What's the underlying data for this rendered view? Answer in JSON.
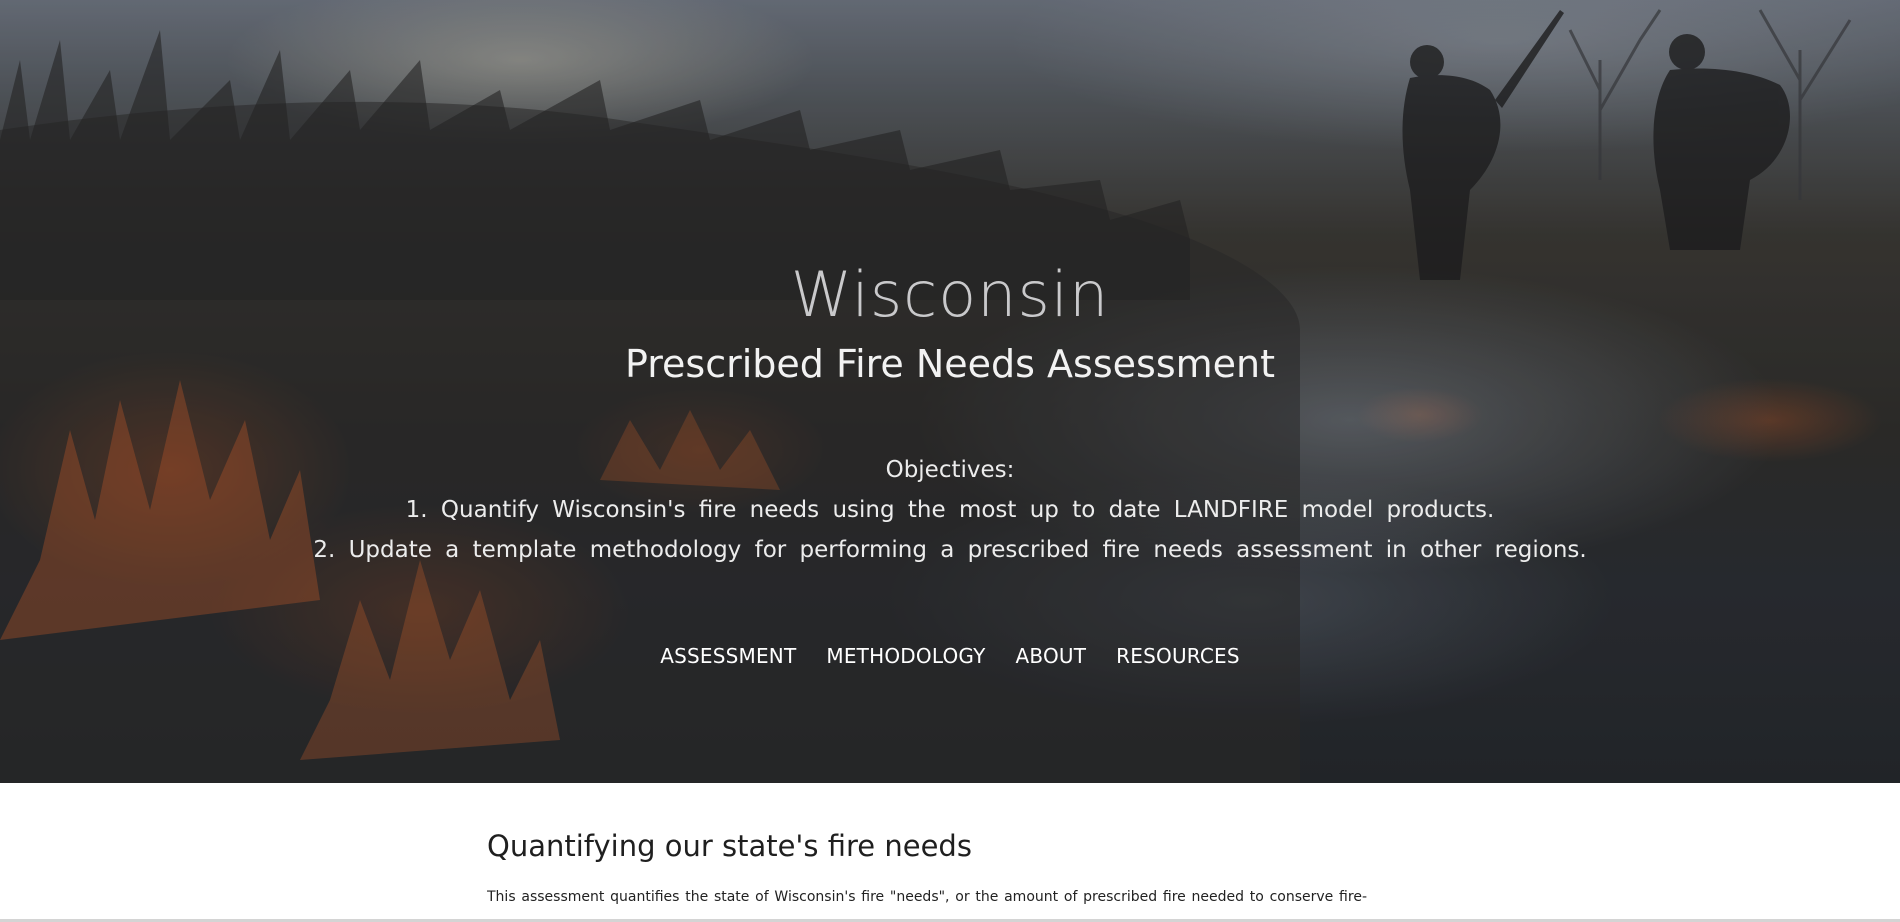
{
  "hero": {
    "title": "Wisconsin",
    "subtitle": "Prescribed Fire Needs Assessment",
    "objectives_heading": "Objectives:",
    "objectives": [
      "1. Quantify Wisconsin's fire needs using the most up to date LANDFIRE model products.",
      "2. Update a template methodology for performing a prescribed fire needs assessment in other regions."
    ],
    "background_image": "prescribed-burn-photo"
  },
  "nav": {
    "items": [
      {
        "label": "ASSESSMENT"
      },
      {
        "label": "METHODOLOGY"
      },
      {
        "label": "ABOUT"
      },
      {
        "label": "RESOURCES"
      }
    ]
  },
  "content": {
    "heading": "Quantifying our state's fire needs",
    "paragraph_visible": "This assessment quantifies the state of Wisconsin's fire \"needs\", or the amount of prescribed fire needed to conserve fire-"
  },
  "colors": {
    "title": "#c9c9cb",
    "text_on_hero": "#ffffff",
    "body_text": "#222222",
    "page_background": "#ffffff"
  }
}
